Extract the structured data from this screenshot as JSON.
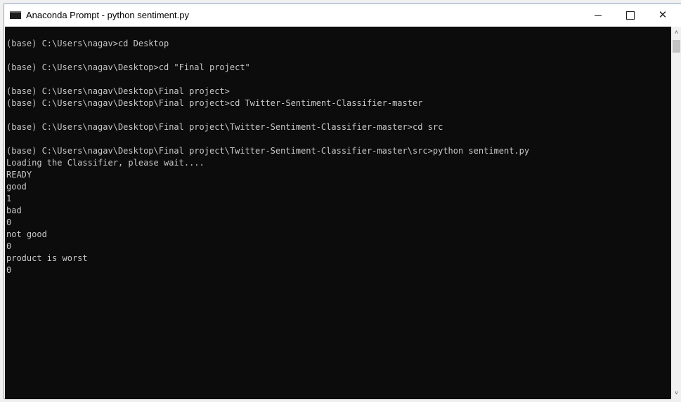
{
  "window": {
    "title": "Anaconda Prompt - python  sentiment.py",
    "controls": {
      "minimize": "—",
      "maximize": "□",
      "close": "✕"
    }
  },
  "console": {
    "lines": [
      "(base) C:\\Users\\nagav>cd Desktop",
      "",
      "(base) C:\\Users\\nagav\\Desktop>cd \"Final project\"",
      "",
      "(base) C:\\Users\\nagav\\Desktop\\Final project>",
      "(base) C:\\Users\\nagav\\Desktop\\Final project>cd Twitter-Sentiment-Classifier-master",
      "",
      "(base) C:\\Users\\nagav\\Desktop\\Final project\\Twitter-Sentiment-Classifier-master>cd src",
      "",
      "(base) C:\\Users\\nagav\\Desktop\\Final project\\Twitter-Sentiment-Classifier-master\\src>python sentiment.py",
      "Loading the Classifier, please wait....",
      "READY",
      "good",
      "1",
      "bad",
      "0",
      "not good",
      "0",
      "product is worst",
      "0"
    ]
  },
  "scrollbar": {
    "up_arrow": "˄",
    "down_arrow": "˅"
  },
  "colors": {
    "console_bg": "#0c0c0c",
    "console_text": "#c8c8c8"
  }
}
